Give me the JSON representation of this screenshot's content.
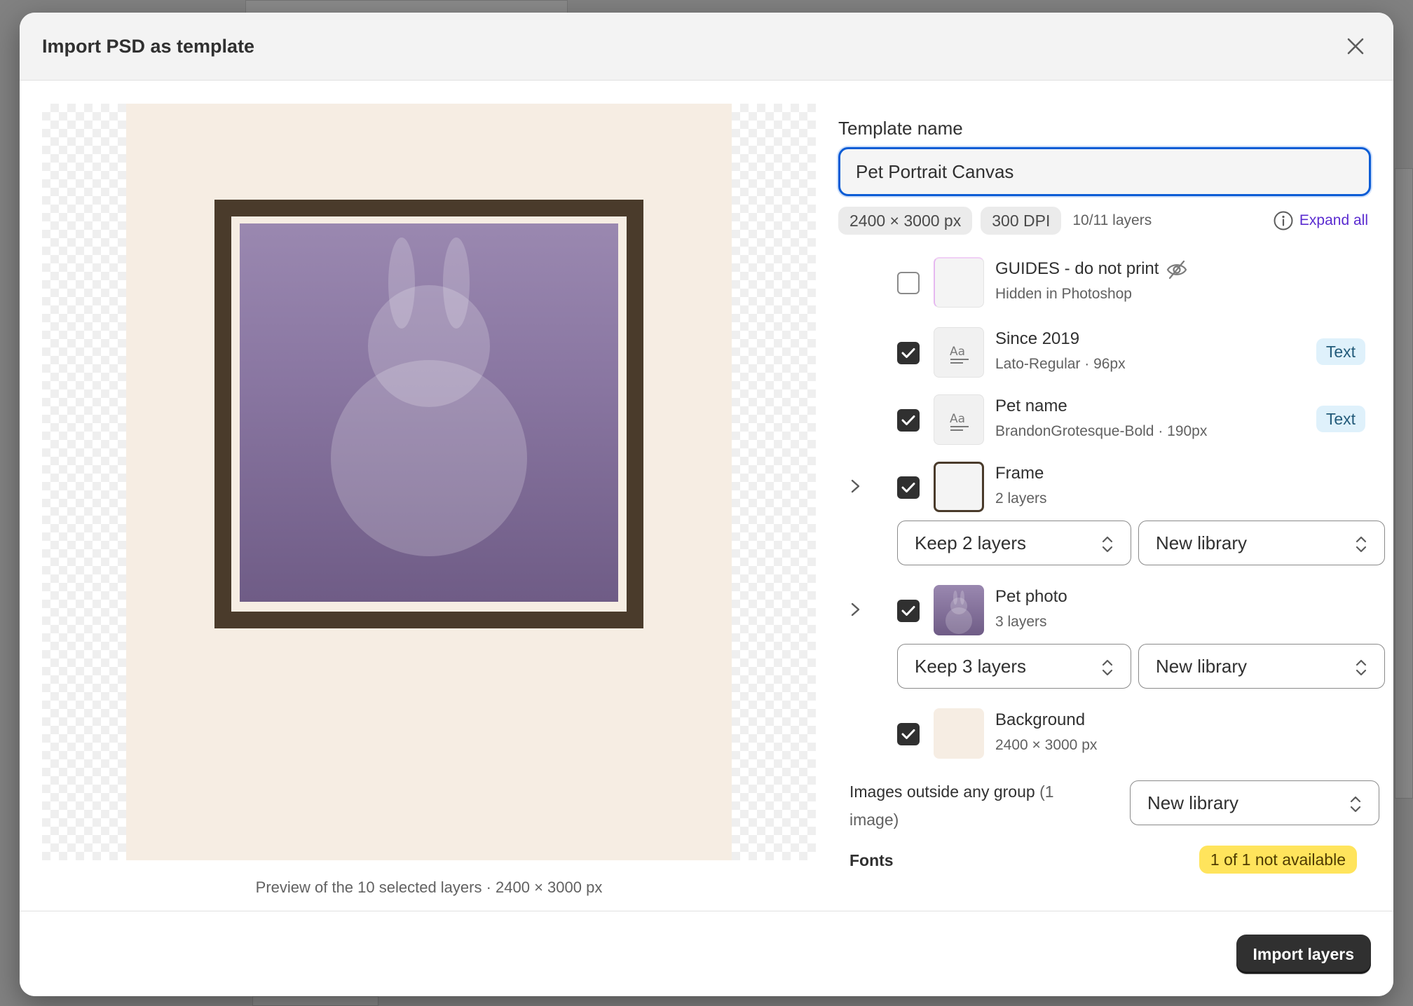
{
  "modal": {
    "title": "Import PSD as template"
  },
  "preview": {
    "caption": "Preview of the 10 selected layers · 2400 × 3000 px"
  },
  "template_name": {
    "label": "Template name",
    "value": "Pet Portrait Canvas"
  },
  "meta": {
    "dimensions": "2400 × 3000 px",
    "dpi": "300 DPI",
    "layers_count": "10/11 layers",
    "expand_all_label": "Expand all"
  },
  "layers": [
    {
      "name": "GUIDES - do not print",
      "sub": "Hidden in Photoshop",
      "checked": false,
      "hidden_icon": "eye-off-icon"
    },
    {
      "name": "Since 2019",
      "sub": "Lato-Regular · 96px",
      "checked": true,
      "badge": "Text",
      "thumb_icon": "text-style-icon"
    },
    {
      "name": "Pet name",
      "sub": "BrandonGrotesque-Bold · 190px",
      "checked": true,
      "badge": "Text",
      "thumb_icon": "text-style-icon"
    },
    {
      "name": "Frame",
      "sub": "2 layers",
      "checked": true,
      "expandable": true,
      "layers_select": "Keep 2 layers",
      "library_select": "New library"
    },
    {
      "name": "Pet photo",
      "sub": "3 layers",
      "checked": true,
      "expandable": true,
      "layers_select": "Keep 3 layers",
      "library_select": "New library"
    },
    {
      "name": "Background",
      "sub": "2400 × 3000 px",
      "checked": true
    }
  ],
  "outside_images": {
    "label": "Images outside any group",
    "count": "(1 image)",
    "select": "New library"
  },
  "fonts": {
    "label": "Fonts",
    "status": "1 of 1 not available"
  },
  "footer": {
    "import_label": "Import layers"
  },
  "colors": {
    "accent": "#0b5cd5",
    "link": "#5a2bd0",
    "primary_button": "#303030",
    "warning_badge": "#ffe45c",
    "text_badge": "#dff1fb",
    "frame_brown": "#4a3b2b",
    "canvas_cream": "#f6ede3"
  }
}
